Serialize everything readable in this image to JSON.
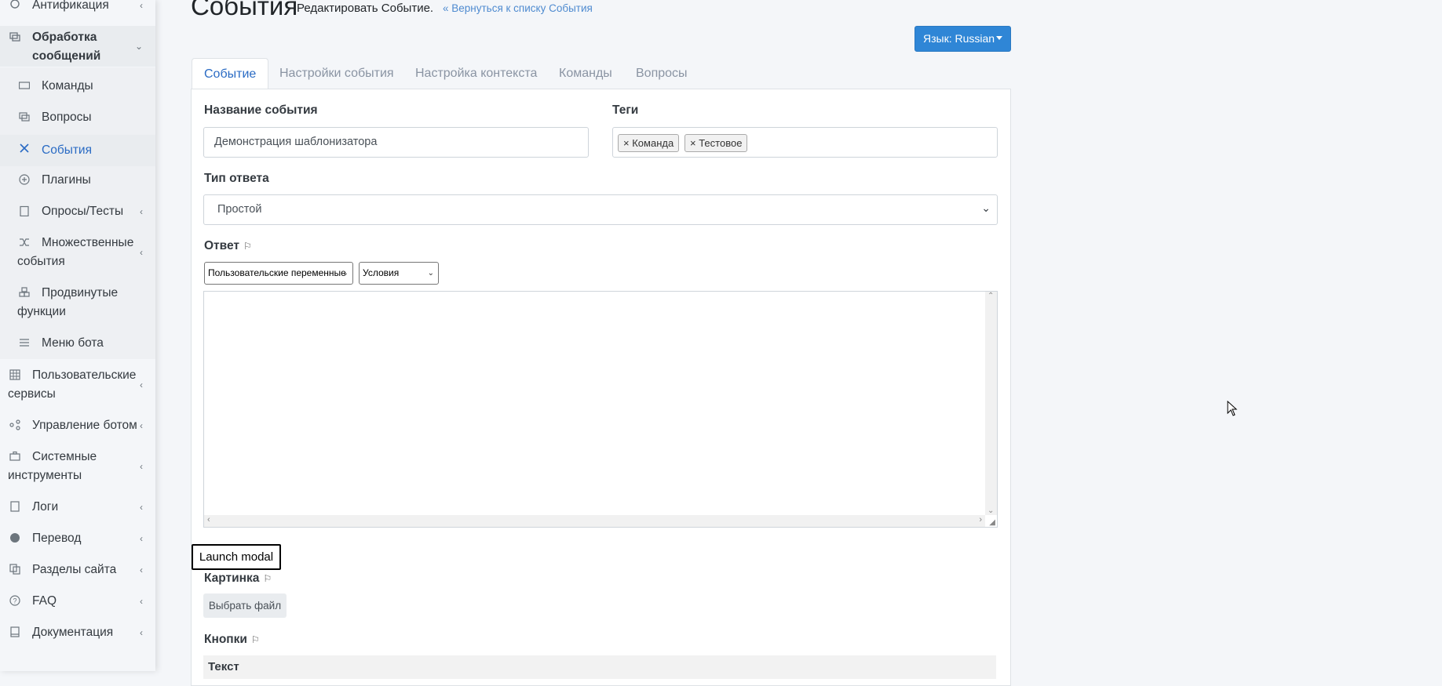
{
  "sidebar": {
    "items": [
      {
        "label": "Антификация",
        "icon": "robot-icon"
      },
      {
        "label": "Обработка сообщений",
        "icon": "chat-icon"
      },
      {
        "label": "Команды",
        "icon": "keyboard-icon"
      },
      {
        "label": "Вопросы",
        "icon": "comments-icon"
      },
      {
        "label": "События",
        "icon": "tools-icon"
      },
      {
        "label": "Плагины",
        "icon": "plus-circle-icon"
      },
      {
        "label": "Опросы/Тесты",
        "icon": "clipboard-icon"
      },
      {
        "label": "Множественные события",
        "icon": "shuffle-icon"
      },
      {
        "label": "Продвинутые функции",
        "icon": "cubes-icon"
      },
      {
        "label": "Меню бота",
        "icon": "bars-icon"
      },
      {
        "label": "Пользовательские сервисы",
        "icon": "table-icon"
      },
      {
        "label": "Управление ботом",
        "icon": "share-icon"
      },
      {
        "label": "Системные инструменты",
        "icon": "briefcase-icon"
      },
      {
        "label": "Логи",
        "icon": "scroll-icon"
      },
      {
        "label": "Перевод",
        "icon": "globe-icon"
      },
      {
        "label": "Разделы сайта",
        "icon": "copy-icon"
      },
      {
        "label": "FAQ",
        "icon": "question-circle-icon"
      },
      {
        "label": "Документация",
        "icon": "book-icon"
      }
    ]
  },
  "header": {
    "title": "События",
    "subtitle": "Редактировать Событие.",
    "back_link": "« Вернуться к списку События",
    "language_button": "Язык: Russian"
  },
  "tabs": [
    "Событие",
    "Настройки события",
    "Настройка контекста",
    "Команды",
    "Вопросы"
  ],
  "form": {
    "name_label": "Название события",
    "name_value": "Демонстрация шаблонизатора",
    "tags_label": "Теги",
    "tags": [
      "Команда",
      "Тестовое"
    ],
    "type_label": "Тип ответа",
    "type_value": "Простой",
    "answer_label": "Ответ",
    "var_select": "Пользовательские переменные",
    "cond_select": "Условия",
    "modal_button": "Launch modal",
    "image_label": "Картинка",
    "file_button": "Выбрать файл",
    "buttons_label": "Кнопки",
    "buttons_col_text": "Текст"
  },
  "colors": {
    "primary": "#2f86d6",
    "link": "#4f8bd0",
    "active_tab": "#2a6bc4"
  }
}
